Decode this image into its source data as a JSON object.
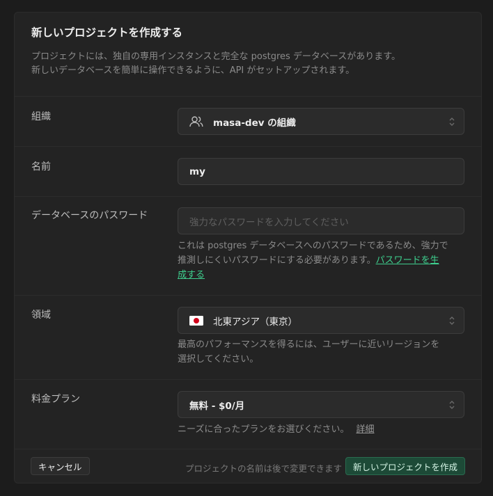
{
  "dialog": {
    "title": "新しいプロジェクトを作成する",
    "description_line1": "プロジェクトには、独自の専用インスタンスと完全な postgres データベースがあります。",
    "description_line2": "新しいデータベースを簡単に操作できるように、API がセットアップされます。"
  },
  "organization": {
    "label": "組織",
    "value": "masa-dev の組織",
    "icon": "users-icon"
  },
  "name": {
    "label": "名前",
    "value": "my"
  },
  "password": {
    "label": "データベースのパスワード",
    "placeholder": "強力なパスワードを入力してください",
    "help_line1": "これは postgres データベースへのパスワードであるため、強力で",
    "help_line2": "推測しにくいパスワードにする必要があります。",
    "generate_link_part1": "パスワードを生",
    "generate_link_part2": "成する"
  },
  "region": {
    "label": "領域",
    "value": "北東アジア（東京）",
    "flag": "japan-flag-icon",
    "help_line1": "最高のパフォーマンスを得るには、ユーザーに近いリージョンを",
    "help_line2": "選択してください。"
  },
  "plan": {
    "label": "料金プラン",
    "value": "無料 - $0/月",
    "help": "ニーズに合ったプランをお選びください。",
    "details_link": "詳細"
  },
  "footer": {
    "cancel_label": "キャンセル",
    "note": "プロジェクトの名前は後で変更できます",
    "create_label": "新しいプロジェクトを作成"
  },
  "colors": {
    "background": "#1c1c1c",
    "panel": "#232323",
    "accent": "#3ecf8e",
    "create_button_bg": "#1d4a37"
  }
}
